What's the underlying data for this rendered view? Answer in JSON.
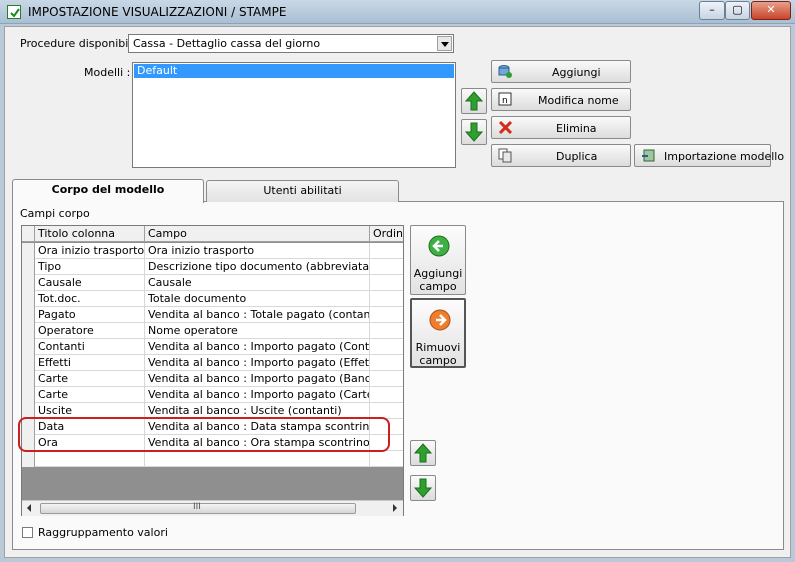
{
  "window": {
    "title": "IMPOSTAZIONE VISUALIZZAZIONI / STAMPE",
    "controls": {
      "minimize": "–",
      "maximize": "▢",
      "close": "✕"
    }
  },
  "procedures": {
    "label": "Procedure disponibili :",
    "selected": "Cassa - Dettaglio cassa del giorno"
  },
  "models": {
    "label": "Modelli :",
    "items": [
      "Default"
    ],
    "selected": "Default"
  },
  "buttons": {
    "add": "Aggiungi",
    "rename": "Modifica nome",
    "delete": "Elimina",
    "duplicate": "Duplica",
    "import": "Importazione modello"
  },
  "tabs": [
    {
      "label": "Corpo del modello",
      "active": true
    },
    {
      "label": "Utenti abilitati",
      "active": false
    }
  ],
  "fields_panel": {
    "label": "Campi corpo",
    "columns": [
      "Titolo colonna",
      "Campo",
      "Ordina"
    ],
    "rows": [
      {
        "title": "Ora inizio trasporto",
        "field": "Ora inizio trasporto"
      },
      {
        "title": "Tipo",
        "field": "Descrizione tipo documento (abbreviata)"
      },
      {
        "title": "Causale",
        "field": "Causale"
      },
      {
        "title": "Tot.doc.",
        "field": "Totale documento"
      },
      {
        "title": "Pagato",
        "field": "Vendita al banco : Totale pagato (contanti+e..."
      },
      {
        "title": "Operatore",
        "field": "Nome operatore"
      },
      {
        "title": "Contanti",
        "field": "Vendita al banco  : Importo pagato (Contanti)"
      },
      {
        "title": "Effetti",
        "field": "Vendita al banco : Importo pagato (Effetti)"
      },
      {
        "title": "Carte",
        "field": "Vendita al banco : Importo pagato (Bancomat)"
      },
      {
        "title": "Carte",
        "field": "Vendita al banco : Importo pagato (Carte)"
      },
      {
        "title": "Uscite",
        "field": "Vendita al banco : Uscite (contanti)"
      },
      {
        "title": "Data",
        "field": "Vendita al banco : Data stampa scontrino"
      },
      {
        "title": "Ora",
        "field": "Vendita al banco : Ora stampa scontrino"
      },
      {
        "title": "",
        "field": ""
      }
    ],
    "add_field": "Aggiungi campo",
    "remove_field": "Rimuovi campo",
    "scroll_grip": "III",
    "grouping_label": "Raggruppamento valori",
    "grouping_checked": false
  },
  "colors": {
    "highlight": "#cc1f1f",
    "selection": "#3399ff",
    "arrow_green": "#2fa02f"
  }
}
